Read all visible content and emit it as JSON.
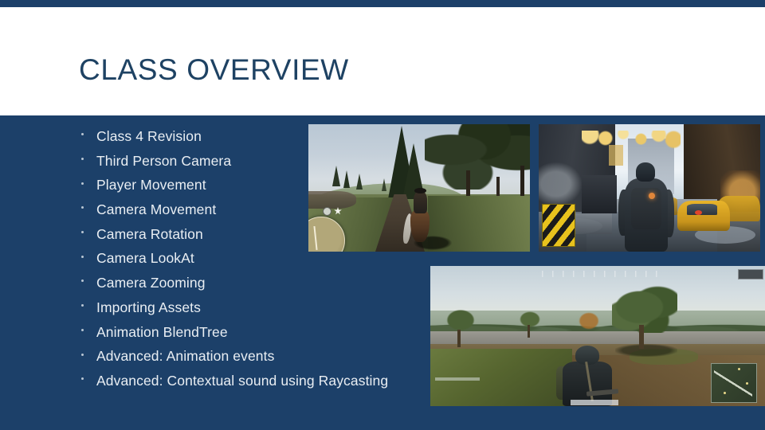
{
  "slide": {
    "title": "CLASS OVERVIEW",
    "accent_color": "#1c4069",
    "title_color": "#1e4263",
    "body_background": "#1c4069",
    "body_text_color": "#e9eef3",
    "header_background": "#ffffff"
  },
  "bullets": [
    {
      "label": "Class 4 Revision"
    },
    {
      "label": "Third Person Camera"
    },
    {
      "label": "Player Movement"
    },
    {
      "label": "Camera Movement"
    },
    {
      "label": "Camera Rotation"
    },
    {
      "label": "Camera LookAt"
    },
    {
      "label": "Camera Zooming"
    },
    {
      "label": "Importing Assets"
    },
    {
      "label": "Animation BlendTree"
    },
    {
      "label": "Advanced: Animation events"
    },
    {
      "label": "Advanced: Contextual sound using Raycasting"
    }
  ],
  "screenshots": [
    {
      "name": "horse-riding-forest-trail",
      "description": "Third person view of a rider on a horse travelling along a dirt trail through a grassy clearing with pine and broadleaf trees, circular minimap at lower left"
    },
    {
      "name": "snowy-city-street",
      "description": "Third person view of a hooded agent with a backpack walking down a snow covered city street with yellow taxis, string lights and a yellow black chevron barrier"
    },
    {
      "name": "open-field-battle-royale",
      "description": "Third person view of a helmeted player with a backpack crouched in an open grassy field beside a road, square minimap at lower right and compass strip at the top"
    }
  ]
}
